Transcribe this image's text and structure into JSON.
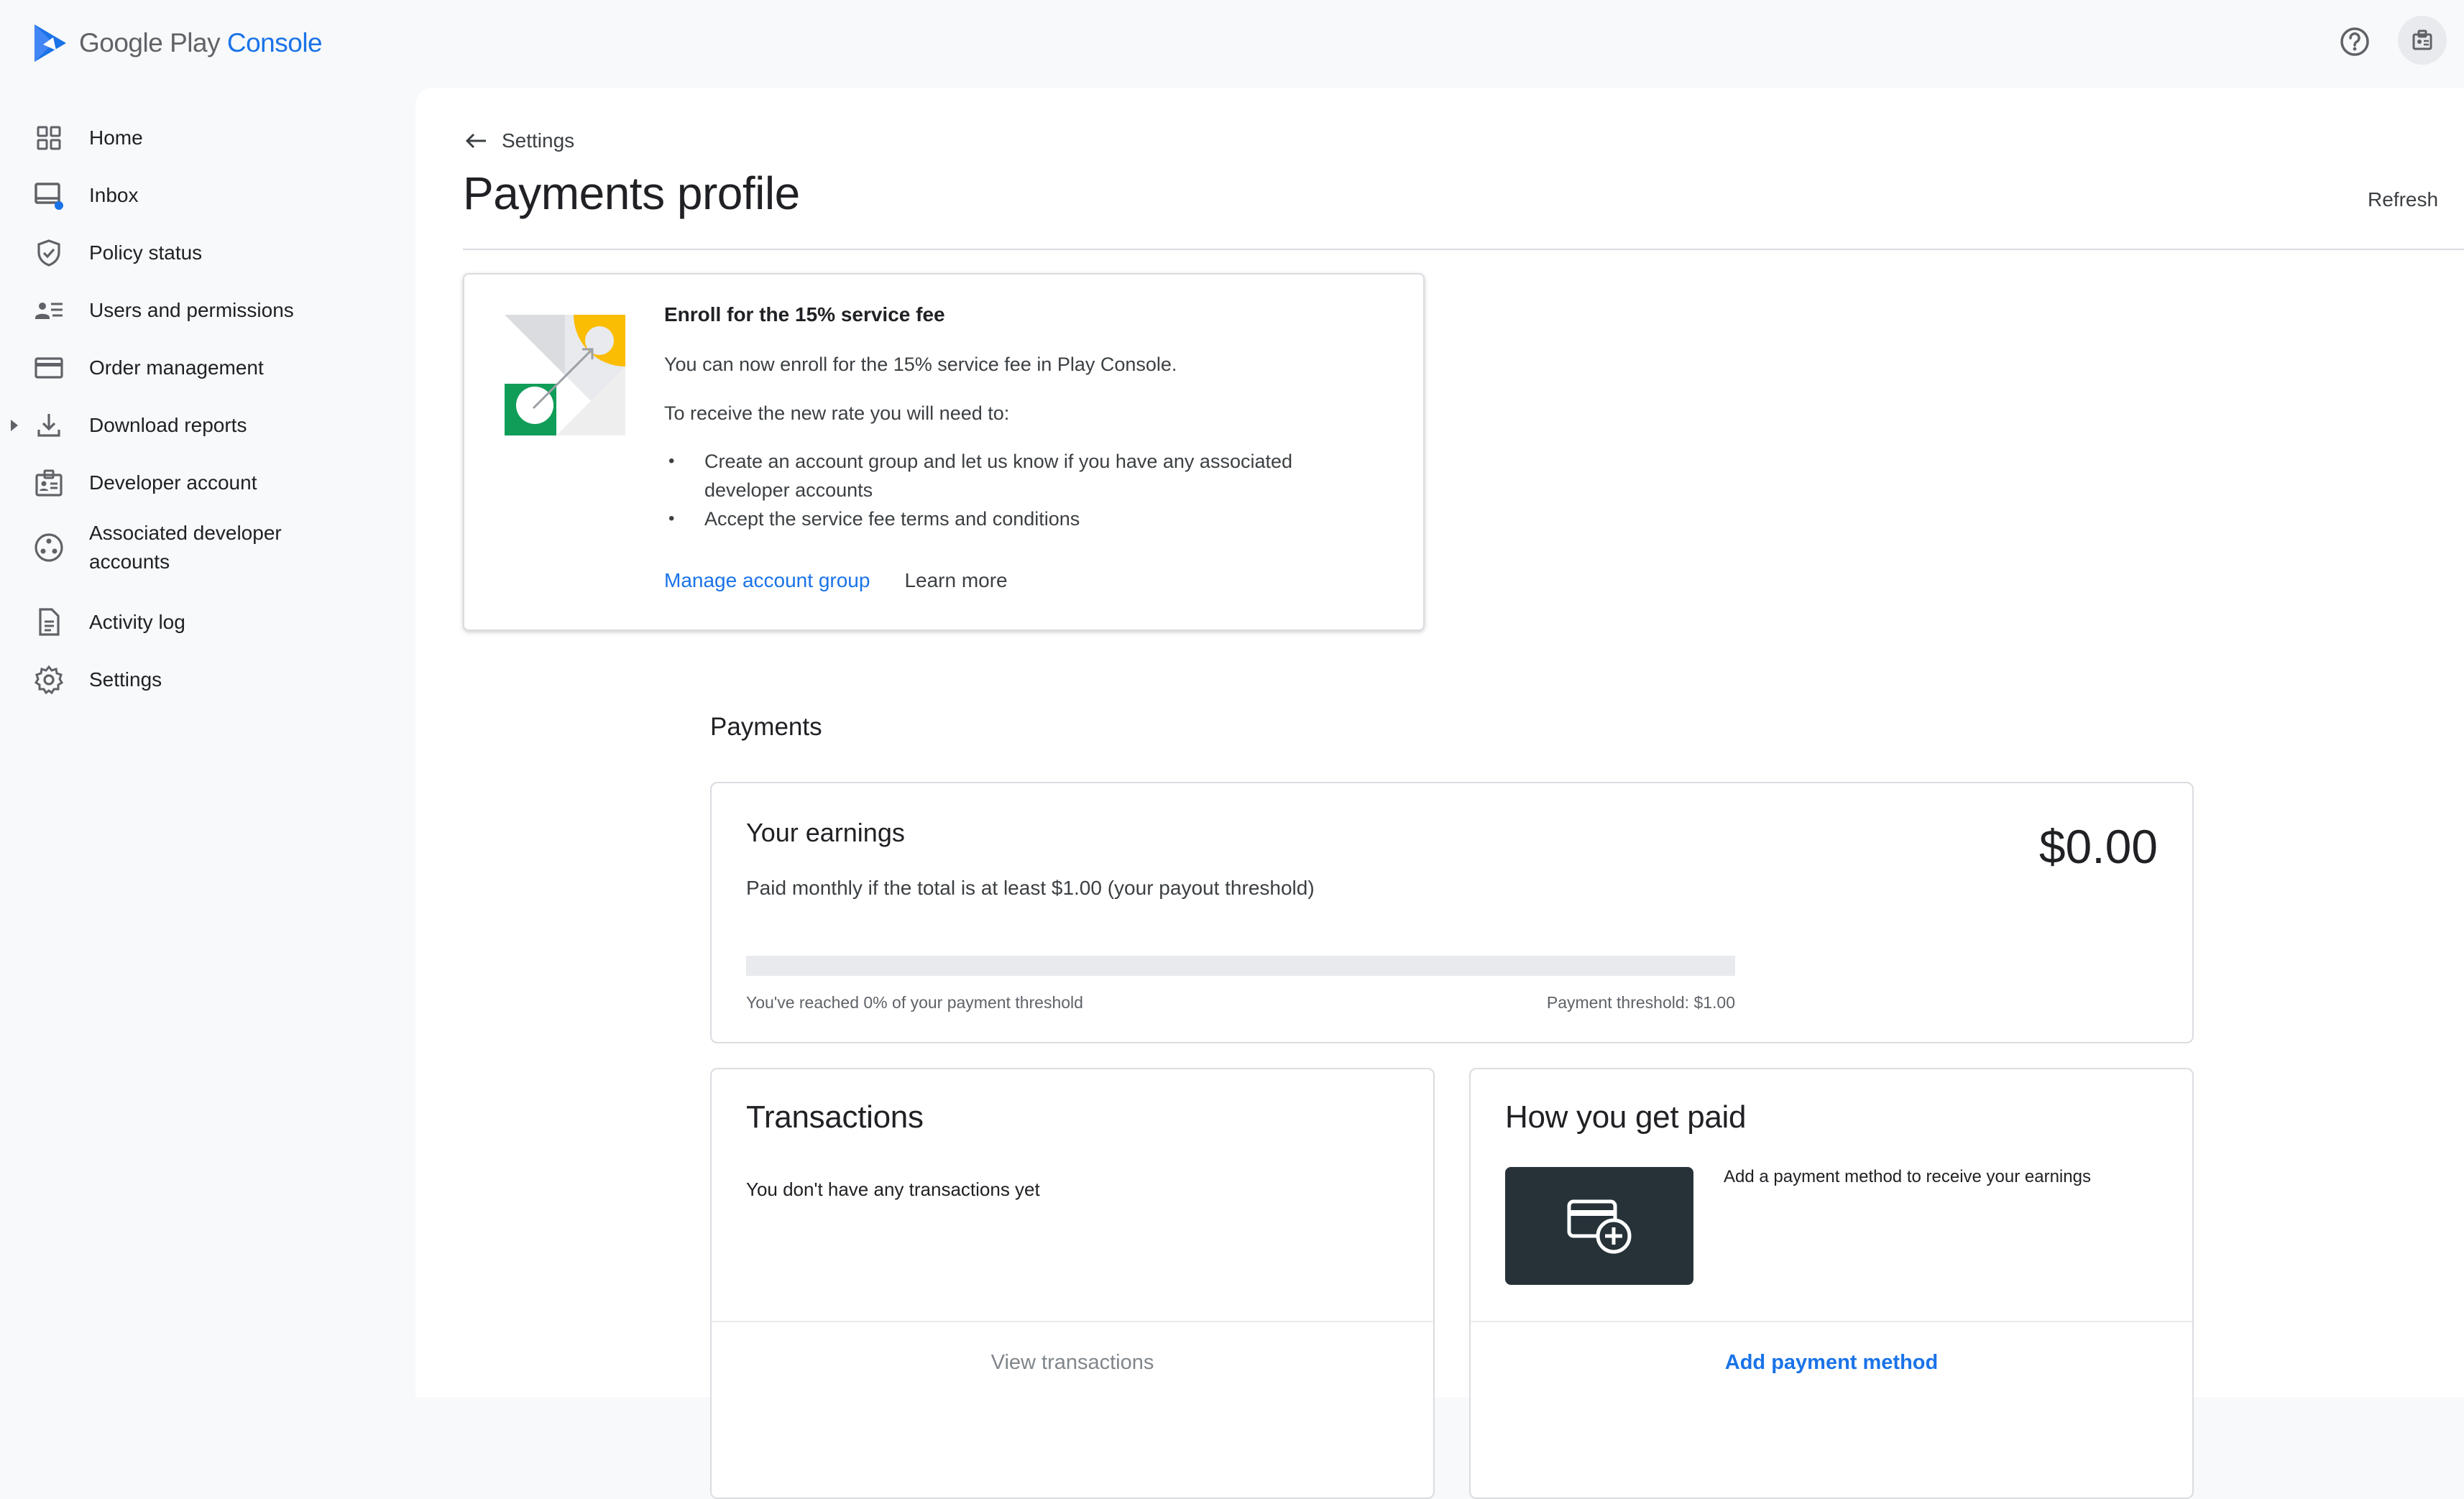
{
  "header": {
    "logo_word1": "Google Play",
    "logo_word2": "Console",
    "help_icon": "help-circle-icon",
    "account_icon": "developer-account-icon"
  },
  "sidebar": {
    "items": [
      {
        "label": "Home",
        "icon": "grid-icon"
      },
      {
        "label": "Inbox",
        "icon": "inbox-icon"
      },
      {
        "label": "Policy status",
        "icon": "shield-check-icon"
      },
      {
        "label": "Users and permissions",
        "icon": "users-icon"
      },
      {
        "label": "Order management",
        "icon": "credit-card-icon"
      },
      {
        "label": "Download reports",
        "icon": "download-icon"
      },
      {
        "label": "Developer account",
        "icon": "id-badge-icon"
      },
      {
        "label": "Associated developer accounts",
        "icon": "linked-accounts-icon"
      },
      {
        "label": "Activity log",
        "icon": "document-icon"
      },
      {
        "label": "Settings",
        "icon": "gear-icon"
      }
    ]
  },
  "breadcrumb": {
    "back_label": "Settings"
  },
  "page": {
    "title": "Payments profile",
    "refresh_label": "Refresh"
  },
  "promo": {
    "title": "Enroll for the 15% service fee",
    "p1": "You can now enroll for the 15% service fee in Play Console.",
    "p2": "To receive the new rate you will need to:",
    "bullets": [
      "Create an account group and let us know if you have any associated developer accounts",
      "Accept the service fee terms and conditions"
    ],
    "link_primary": "Manage account group",
    "link_secondary": "Learn more"
  },
  "payments": {
    "section_title": "Payments",
    "earnings": {
      "title": "Your earnings",
      "amount": "$0.00",
      "subtitle": "Paid monthly if the total is at least $1.00 (your payout threshold)",
      "progress_fraction": 0,
      "progress_left": "You've reached 0% of your payment threshold",
      "progress_right": "Payment threshold: $1.00"
    },
    "transactions": {
      "title": "Transactions",
      "empty": "You don't have any transactions yet",
      "action": "View transactions"
    },
    "how_paid": {
      "title": "How you get paid",
      "text": "Add a payment method to receive your earnings",
      "action": "Add payment method",
      "tile_icon": "add-card-icon"
    }
  },
  "colors": {
    "accent": "#1a73e8",
    "sidebar_bg": "#f8f9fa",
    "tile_bg": "#263238"
  }
}
